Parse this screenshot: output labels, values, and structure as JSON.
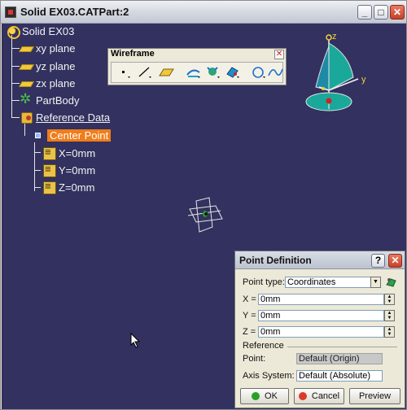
{
  "window": {
    "title": "Solid EX03.CATPart:2",
    "minimize": "_",
    "maximize": "□",
    "close": "✕"
  },
  "tree": {
    "root": "Solid EX03",
    "items": [
      {
        "label": "xy plane"
      },
      {
        "label": "yz plane"
      },
      {
        "label": "zx plane"
      },
      {
        "label": "PartBody"
      },
      {
        "label": "Reference Data"
      },
      {
        "label": "Center Point"
      },
      {
        "label": "X=0mm"
      },
      {
        "label": "Y=0mm"
      },
      {
        "label": "Z=0mm"
      }
    ]
  },
  "toolbar": {
    "title": "Wireframe",
    "close": "✕"
  },
  "compass": {
    "z_label": "z",
    "y_label": "y"
  },
  "dialog": {
    "title": "Point Definition",
    "help": "?",
    "close": "✕",
    "point_type_label": "Point type:",
    "point_type_value": "Coordinates",
    "x_label": "X =",
    "x_value": "0mm",
    "y_label": "Y =",
    "y_value": "0mm",
    "z_label": "Z =",
    "z_value": "0mm",
    "reference_header": "Reference",
    "point_label": "Point:",
    "point_value": "Default (Origin)",
    "axis_label": "Axis System:",
    "axis_value": "Default (Absolute)",
    "ok_label": "OK",
    "cancel_label": "Cancel",
    "preview_label": "Preview"
  },
  "colors": {
    "viewport_bg": "#32315f",
    "selection": "#ef7d1a",
    "ok_dot": "#2aa02a",
    "cancel_dot": "#d93b2b"
  }
}
